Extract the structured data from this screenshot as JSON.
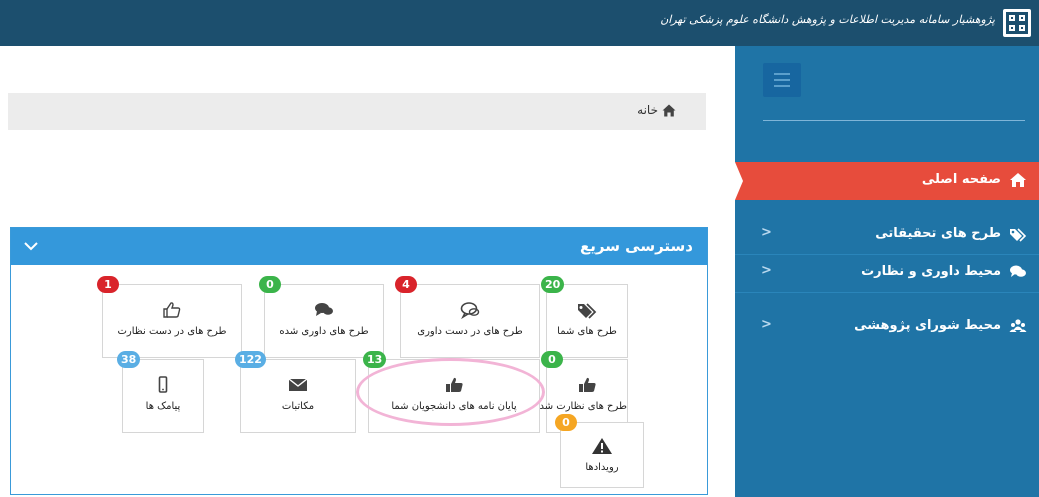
{
  "brand": {
    "name": "پژوهشیار سامانه مدیریت اطلاعات و پژوهش دانشگاه علوم پزشکی تهران"
  },
  "icons": {
    "logo": "university-logo-icon",
    "menu": "hamburger-menu-icon",
    "home": "home-icon",
    "tags": "tags-icon",
    "comments": "comments-icon",
    "users": "users-icon",
    "chevron": "chevron-icon",
    "thumbs_up_outline": "thumbs-up-outline-icon",
    "thumbs_up": "thumbs-up-icon",
    "comment_outline": "comment-outline-icon",
    "mobile": "mobile-icon",
    "envelope": "envelope-icon",
    "warning": "warning-icon"
  },
  "sidebar": {
    "items": [
      {
        "label": "صفحه اصلی",
        "active": true
      },
      {
        "label": "طرح های تحقیقاتی",
        "chevron": "<"
      },
      {
        "label": "محیط داوری و نظارت",
        "chevron": "<"
      },
      {
        "label": "محیط شورای پژوهشی",
        "chevron": "<"
      }
    ]
  },
  "breadcrumb": {
    "home_label": "خانه"
  },
  "quick_access": {
    "title": "دسترسی سریع",
    "tiles": [
      {
        "label": "طرح های شما",
        "badge": "20"
      },
      {
        "label": "طرح های در دست داوری",
        "badge": "4"
      },
      {
        "label": "طرح های داوری شده",
        "badge": "0"
      },
      {
        "label": "طرح های در دست نظارت",
        "badge": "1"
      },
      {
        "label": "طرح های نظارت شده",
        "badge": "0"
      },
      {
        "label": "پایان نامه های دانشجویان شما",
        "badge": "13"
      },
      {
        "label": "مکاتبات",
        "badge": "122"
      },
      {
        "label": "پیامک ها",
        "badge": "38"
      },
      {
        "label": "رویدادها",
        "badge": "0"
      }
    ]
  },
  "colors": {
    "topbar": "#1c4f6e",
    "sidebar": "#1f74a6",
    "active_item": "#e74c3c",
    "panel_header": "#3498db",
    "badge_red": "#d9242b",
    "badge_green": "#3bb44a",
    "badge_blue": "#5aaee4",
    "badge_orange": "#f5a623",
    "highlight": "#f2b4d6"
  }
}
